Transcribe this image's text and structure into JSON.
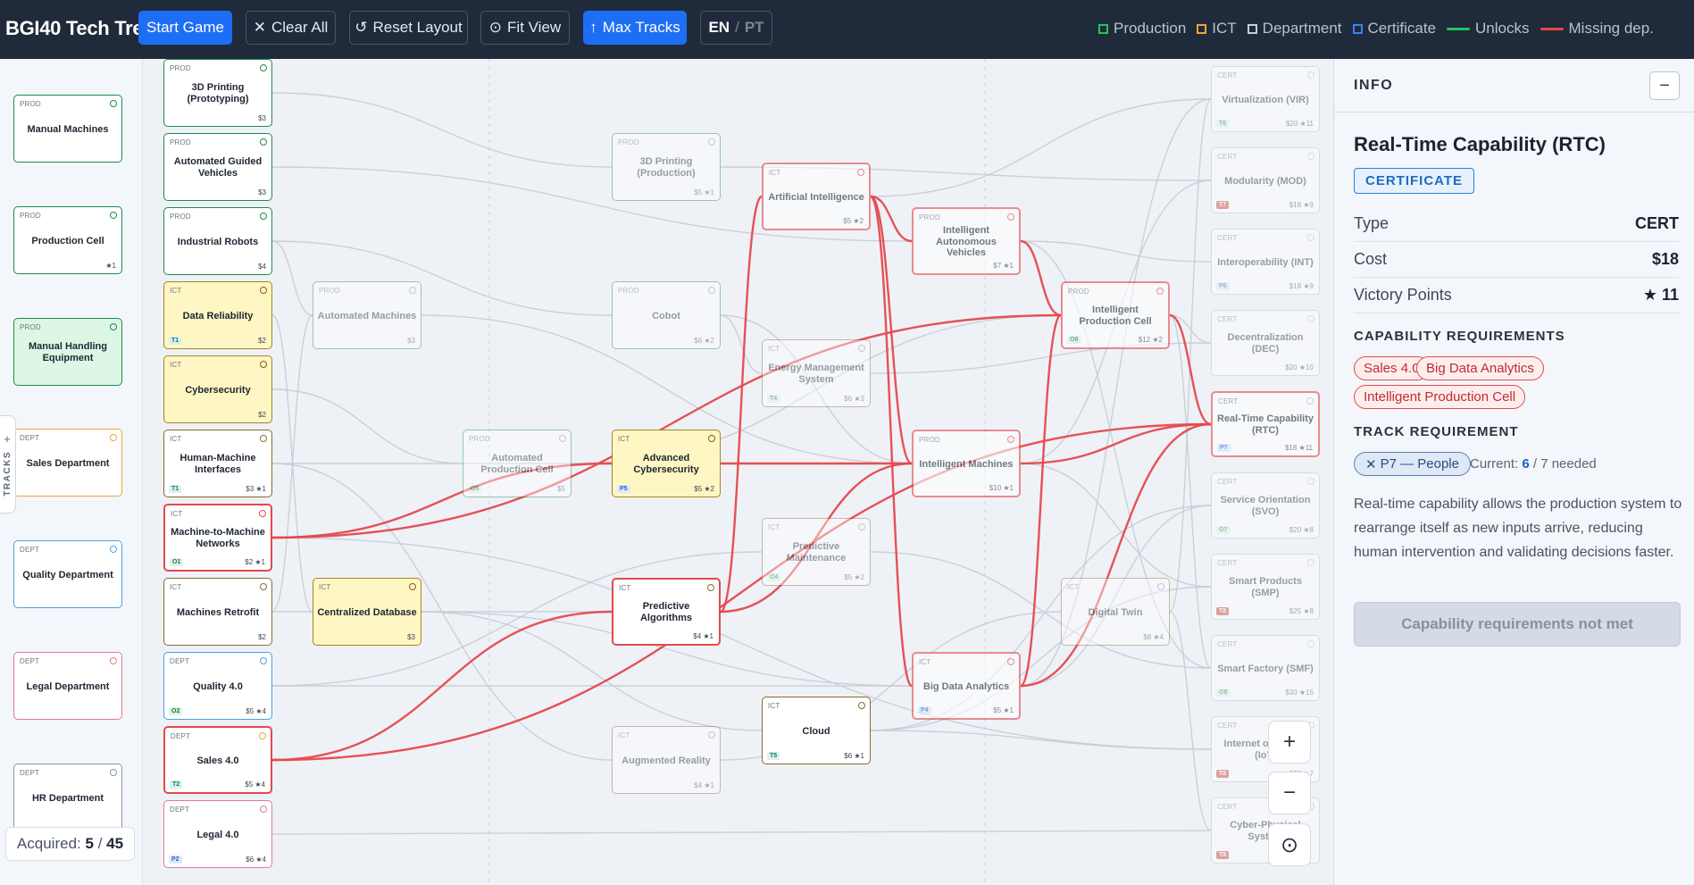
{
  "app_title": "BGI40 Tech Tree",
  "toolbar": {
    "start_game": "Start Game",
    "clear_all": "Clear All",
    "reset_layout": "Reset Layout",
    "fit_view": "Fit View",
    "max_tracks": "Max Tracks",
    "lang_en": "EN",
    "lang_sep": "/",
    "lang_pt": "PT"
  },
  "legend": {
    "production": "Production",
    "ict": "ICT",
    "department": "Department",
    "certificate": "Certificate",
    "unlocks": "Unlocks",
    "missing_dep": "Missing dep.",
    "colors": {
      "production": "#22c55e",
      "ict": "#f0a33a",
      "department": "#c9ced6",
      "certificate": "#3b82f6",
      "unlocks": "#22c55e",
      "missing": "#ef4444"
    }
  },
  "left_nodes": [
    {
      "tag": "PROD",
      "name": "Manual Machines",
      "meta": ""
    },
    {
      "tag": "PROD",
      "name": "Production Cell",
      "meta": "★1"
    },
    {
      "tag": "PROD",
      "name": "Manual Handling Equipment",
      "meta": ""
    },
    {
      "tag": "DEPT",
      "name": "Sales Department",
      "meta": ""
    },
    {
      "tag": "DEPT",
      "name": "Quality Department",
      "meta": ""
    },
    {
      "tag": "DEPT",
      "name": "Legal Department",
      "meta": ""
    },
    {
      "tag": "DEPT",
      "name": "HR Department",
      "meta": ""
    }
  ],
  "col2": [
    {
      "tag": "PROD",
      "name": "3D Printing (Prototyping)",
      "meta": "$3",
      "track": ""
    },
    {
      "tag": "PROD",
      "name": "Automated Guided Vehicles",
      "meta": "$3",
      "track": ""
    },
    {
      "tag": "PROD",
      "name": "Industrial Robots",
      "meta": "$4",
      "track": ""
    },
    {
      "tag": "ICT",
      "name": "Data Reliability",
      "meta": "$2",
      "track": "T1"
    },
    {
      "tag": "ICT",
      "name": "Cybersecurity",
      "meta": "$2",
      "track": ""
    },
    {
      "tag": "ICT",
      "name": "Human-Machine Interfaces",
      "meta": "$3 ★1",
      "track": "T1"
    },
    {
      "tag": "ICT",
      "name": "Machine-to-Machine Networks",
      "meta": "$2 ★1",
      "track": "O1"
    },
    {
      "tag": "ICT",
      "name": "Machines Retrofit",
      "meta": "$2",
      "track": ""
    },
    {
      "tag": "DEPT",
      "name": "Quality 4.0",
      "meta": "$5 ★4",
      "track": "O2"
    },
    {
      "tag": "DEPT",
      "name": "Sales 4.0",
      "meta": "$5 ★4",
      "track": "T2"
    },
    {
      "tag": "DEPT",
      "name": "Legal 4.0",
      "meta": "$6 ★4",
      "track": "P2"
    }
  ],
  "col3": [
    {
      "tag": "PROD",
      "name": "Automated Machines",
      "meta": "$3",
      "track": ""
    },
    {
      "tag": "ICT",
      "name": "Centralized Database",
      "meta": "$3",
      "track": ""
    }
  ],
  "col4": [
    {
      "tag": "PROD",
      "name": "Automated Production Cell",
      "meta": "$5",
      "track": "O5"
    }
  ],
  "col5": [
    {
      "tag": "PROD",
      "name": "3D Printing (Production)",
      "meta": "$5 ★1",
      "track": ""
    },
    {
      "tag": "PROD",
      "name": "Cobot",
      "meta": "$6 ★2",
      "track": ""
    },
    {
      "tag": "ICT",
      "name": "Advanced Cybersecurity",
      "meta": "$5 ★2",
      "track": "P5"
    },
    {
      "tag": "ICT",
      "name": "Predictive Algorithms",
      "meta": "$4 ★1",
      "track": ""
    },
    {
      "tag": "ICT",
      "name": "Augmented Reality",
      "meta": "$4 ★1",
      "track": ""
    }
  ],
  "col6": [
    {
      "tag": "ICT",
      "name": "Artificial Intelligence",
      "meta": "$5 ★2",
      "track": ""
    },
    {
      "tag": "ICT",
      "name": "Energy Management System",
      "meta": "$6 ★3",
      "track": "T4"
    },
    {
      "tag": "ICT",
      "name": "Predictive Maintenance",
      "meta": "$5 ★2",
      "track": "O4"
    },
    {
      "tag": "ICT",
      "name": "Cloud",
      "meta": "$6 ★1",
      "track": "T5"
    }
  ],
  "col7": [
    {
      "tag": "PROD",
      "name": "Intelligent Autonomous Vehicles",
      "meta": "$7 ★1",
      "track": ""
    },
    {
      "tag": "PROD",
      "name": "Intelligent Machines",
      "meta": "$10 ★1",
      "track": ""
    },
    {
      "tag": "ICT",
      "name": "Big Data Analytics",
      "meta": "$5 ★1",
      "track": "P4"
    }
  ],
  "col8": [
    {
      "tag": "PROD",
      "name": "Intelligent Production Cell",
      "meta": "$12 ★2",
      "track": "O6"
    },
    {
      "tag": "ICT",
      "name": "Digital Twin",
      "meta": "$8 ★4",
      "track": ""
    }
  ],
  "certs": [
    {
      "tag": "CERT",
      "name": "Virtualization (VIR)",
      "meta": "$20 ★11",
      "track": "T6"
    },
    {
      "tag": "CERT",
      "name": "Modularity (MOD)",
      "meta": "$18 ★9",
      "track": "T7"
    },
    {
      "tag": "CERT",
      "name": "Interoperability (INT)",
      "meta": "$18 ★9",
      "track": "P6"
    },
    {
      "tag": "CERT",
      "name": "Decentralization (DEC)",
      "meta": "$20 ★10",
      "track": ""
    },
    {
      "tag": "CERT",
      "name": "Real-Time Capability (RTC)",
      "meta": "$18 ★11",
      "track": "P7"
    },
    {
      "tag": "CERT",
      "name": "Service Orientation (SVO)",
      "meta": "$20 ★8",
      "track": "O7"
    },
    {
      "tag": "CERT",
      "name": "Smart Products (SMP)",
      "meta": "$25 ★8",
      "track": "T8"
    },
    {
      "tag": "CERT",
      "name": "Smart Factory (SMF)",
      "meta": "$30 ★15",
      "track": "O8"
    },
    {
      "tag": "CERT",
      "name": "Internet of Things (IoT)",
      "meta": "$20 ★7",
      "track": "T8"
    },
    {
      "tag": "CERT",
      "name": "Cyber-Physical System",
      "meta": "",
      "track": "T8"
    }
  ],
  "tracks_tab": "TRACKS",
  "tracks_plus": "+",
  "acquired": {
    "label": "Acquired:",
    "value": "5",
    "sep": "/",
    "total": "45"
  },
  "zoom": {
    "in": "+",
    "out": "−",
    "center": "⊙"
  },
  "info": {
    "header": "INFO",
    "collapse": "−",
    "title": "Real-Time Capability (RTC)",
    "badge": "CERTIFICATE",
    "type_label": "Type",
    "type_value": "CERT",
    "cost_label": "Cost",
    "cost_value": "$18",
    "vp_label": "Victory Points",
    "vp_value": "★ 11",
    "cap_req_title": "CAPABILITY REQUIREMENTS",
    "cap_reqs": [
      "Sales 4.0",
      "Big Data Analytics",
      "Intelligent Production Cell"
    ],
    "track_req_title": "TRACK REQUIREMENT",
    "track_pill": "P7 — People",
    "track_current_label": "Current:",
    "track_current_value": "6",
    "track_needed": "/ 7 needed",
    "description": "Real-time capability allows the production system to rearrange itself as new inputs arrive, reducing human intervention and validating decisions faster.",
    "action": "Capability requirements not met"
  }
}
